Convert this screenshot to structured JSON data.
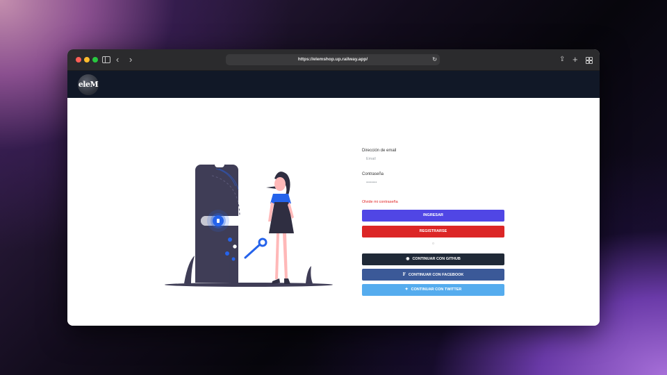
{
  "browser": {
    "url": "https://elemshop.up.railway.app/",
    "icons": {
      "back": "chevron-left-icon",
      "forward": "chevron-right-icon",
      "reload": "reload-icon",
      "share": "share-icon",
      "new_tab": "plus-icon",
      "tabs": "tab-overview-icon"
    }
  },
  "navbar": {
    "logo_text": "eleM"
  },
  "login_form": {
    "email_label": "Dirección de email",
    "email_placeholder": "Email",
    "password_label": "Contraseña",
    "password_placeholder": "••••••••",
    "forgot_password": "Olvide mi contraseña",
    "login_button": "INGRESAR",
    "register_button": "REGISTRARSE",
    "separator": "o",
    "github_button": "CONTINUAR CON GITHUB",
    "facebook_button": "CONTINUAR CON FACEBOOK",
    "twitter_button": "CONTINUAR CON TWITTER"
  },
  "colors": {
    "navbar": "#111827",
    "login": "#5046e5",
    "register": "#dc2626",
    "github": "#1f2937",
    "facebook": "#3b5998",
    "twitter": "#55acee",
    "accent_blue": "#2563eb"
  }
}
